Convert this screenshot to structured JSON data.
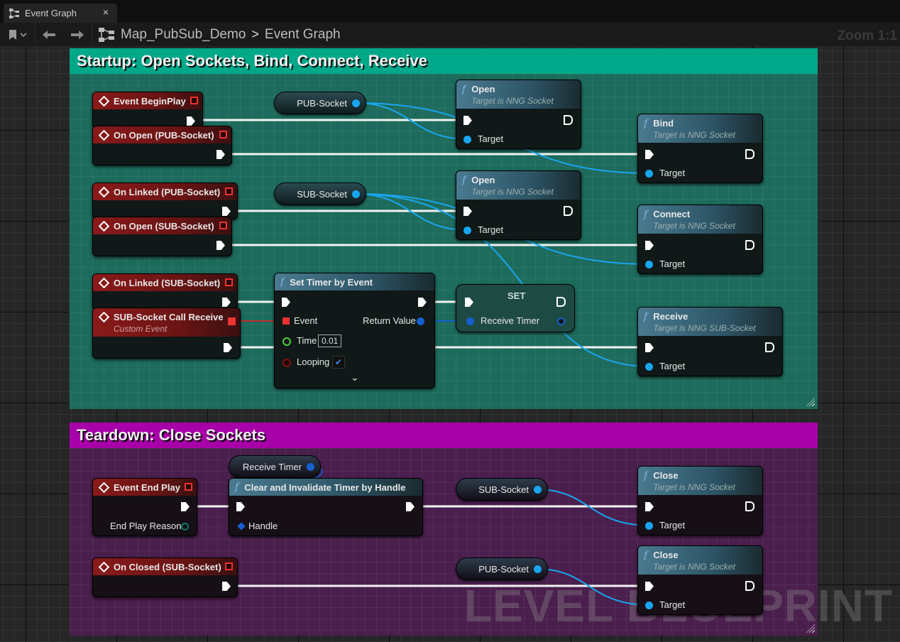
{
  "tab": {
    "label": "Event Graph",
    "close": "×"
  },
  "breadcrumb": {
    "root": "Map_PubSub_Demo",
    "separator": ">",
    "current": "Event Graph"
  },
  "zoom": "Zoom 1:1",
  "watermark": "LEVEL BLUEPRINT",
  "comments": {
    "startup": {
      "title": "Startup: Open Sockets, Bind, Connect, Receive",
      "color": "#00a88a"
    },
    "teardown": {
      "title": "Teardown: Close Sockets",
      "color": "#a800a8"
    }
  },
  "events": {
    "begin_play": "Event BeginPlay",
    "on_open_pub": "On Open (PUB-Socket)",
    "on_linked_pub": "On Linked (PUB-Socket)",
    "on_open_sub": "On Open (SUB-Socket)",
    "on_linked_sub": "On Linked (SUB-Socket)",
    "sub_call_receive": "SUB-Socket Call Receive",
    "sub_call_receive_sub": "Custom Event",
    "end_play": "Event End Play",
    "end_play_reason": "End Play Reason",
    "on_closed_sub": "On Closed (SUB-Socket)"
  },
  "vars": {
    "pub_socket": "PUB-Socket",
    "sub_socket": "SUB-Socket",
    "receive_timer": "Receive Timer"
  },
  "functions": {
    "open1": {
      "title": "Open",
      "sub": "Target is NNG Socket",
      "target": "Target"
    },
    "open2": {
      "title": "Open",
      "sub": "Target is NNG Socket",
      "target": "Target"
    },
    "bind": {
      "title": "Bind",
      "sub": "Target is NNG Socket",
      "target": "Target"
    },
    "connect": {
      "title": "Connect",
      "sub": "Target is NNG Socket",
      "target": "Target"
    },
    "receive": {
      "title": "Receive",
      "sub": "Target is NNG SUB-Socket",
      "target": "Target"
    },
    "set_timer": {
      "title": "Set Timer by Event",
      "event": "Event",
      "return": "Return Value",
      "time": "Time",
      "time_value": "0.01",
      "looping": "Looping",
      "looping_checked": true,
      "expand": "⌄"
    },
    "set": {
      "title": "SET",
      "pin": "Receive Timer"
    },
    "clear_timer": {
      "title": "Clear and Invalidate Timer by Handle",
      "handle": "Handle"
    },
    "close1": {
      "title": "Close",
      "sub": "Target is NNG Socket",
      "target": "Target"
    },
    "close2": {
      "title": "Close",
      "sub": "Target is NNG Socket",
      "target": "Target"
    }
  }
}
